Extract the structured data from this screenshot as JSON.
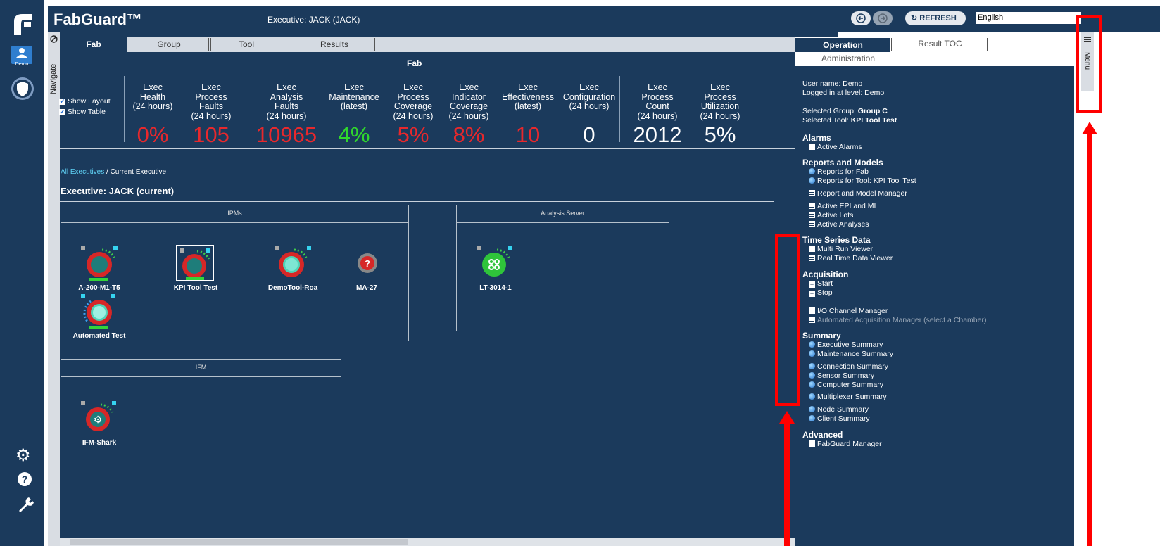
{
  "app": {
    "name": "FabGuard™",
    "executive_title": "Executive: JACK (JACK)"
  },
  "header": {
    "refresh_label": "REFRESH",
    "language": "English"
  },
  "left_nav": {
    "user_label": "Demo"
  },
  "side_strip": {
    "label": "Navigate"
  },
  "tabs": [
    {
      "label": "Fab",
      "active": true
    },
    {
      "label": "Group",
      "active": false
    },
    {
      "label": "Tool",
      "active": false
    },
    {
      "label": "Results",
      "active": false
    }
  ],
  "fab": {
    "title": "Fab",
    "show_layout": "Show Layout",
    "show_table": "Show Table",
    "metrics": [
      {
        "label": "Exec\nHealth\n(24 hours)",
        "value": "0%",
        "color": "red"
      },
      {
        "label": "Exec\nProcess\nFaults\n(24 hours)",
        "value": "105",
        "color": "red"
      },
      {
        "label": "Exec\nAnalysis\nFaults\n(24 hours)",
        "value": "10965",
        "color": "red"
      },
      {
        "label": "Exec\nMaintenance\n(latest)",
        "value": "4%",
        "color": "green"
      },
      {
        "label": "Exec\nProcess\nCoverage\n(24 hours)",
        "value": "5%",
        "color": "red"
      },
      {
        "label": "Exec\nIndicator\nCoverage\n(24 hours)",
        "value": "8%",
        "color": "red"
      },
      {
        "label": "Exec\nEffectiveness\n(latest)",
        "value": "10",
        "color": "red"
      },
      {
        "label": "Exec\nConfiguration\n(24 hours)",
        "value": "0",
        "color": "white"
      },
      {
        "label": "Exec\nProcess\nCount\n(24 hours)",
        "value": "2012",
        "color": "white"
      },
      {
        "label": "Exec\nProcess\nUtilization\n(24 hours)",
        "value": "5%",
        "color": "white"
      }
    ]
  },
  "breadcrumb": {
    "link": "All Executives",
    "current": " / Current Executive"
  },
  "executive_heading": "Executive: JACK  (current)",
  "panels": {
    "ipms": {
      "title": "IPMs",
      "nodes": [
        "A-200-M1-T5",
        "KPI Tool Test",
        "DemoTool-Roa",
        "MA-27",
        "Automated Test"
      ]
    },
    "analysis": {
      "title": "Analysis Server",
      "nodes": [
        "LT-3014-1"
      ]
    },
    "ifm": {
      "title": "IFM",
      "nodes": [
        "IFM-Shark"
      ]
    }
  },
  "right": {
    "tabs": [
      "Operation",
      "Result TOC",
      "Administration"
    ],
    "menu_label": "Menu",
    "user_name": "User name: Demo",
    "logged_in": "Logged in at level: Demo",
    "selected_group_label": "Selected Group: ",
    "selected_group": "Group C",
    "selected_tool_label": "Selected Tool: ",
    "selected_tool": "KPI Tool Test",
    "sections": {
      "alarms": "Alarms",
      "reports": "Reports and Models",
      "tsd": "Time Series Data",
      "acq": "Acquisition",
      "summary": "Summary",
      "advanced": "Advanced"
    },
    "items": {
      "active_alarms": "Active Alarms",
      "reports_fab": "Reports for Fab",
      "reports_tool": "Reports for Tool: KPI Tool Test",
      "rmm": "Report and Model Manager",
      "epi": "Active EPI and MI",
      "lots": "Active Lots",
      "analyses": "Active Analyses",
      "multirun": "Multi Run Viewer",
      "realtime": "Real Time Data Viewer",
      "start": "Start",
      "stop": "Stop",
      "io": "I/O Channel Manager",
      "aam": "Automated Acquisition Manager (select a Chamber)",
      "exec_sum": "Executive Summary",
      "maint_sum": "Maintenance Summary",
      "conn_sum": "Connection Summary",
      "sensor_sum": "Sensor Summary",
      "comp_sum": "Computer Summary",
      "mux_sum": "Multiplexer Summary",
      "node_sum": "Node Summary",
      "client_sum": "Client Summary",
      "fgm": "FabGuard Manager"
    }
  }
}
